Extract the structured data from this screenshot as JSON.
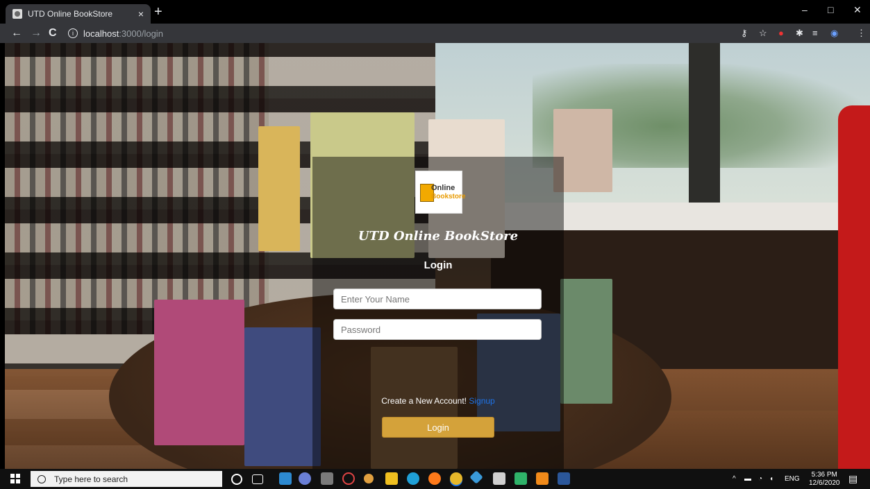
{
  "browser": {
    "tab_title": "UTD Online BookStore",
    "tab_close": "×",
    "new_tab": "+",
    "url_host": "localhost",
    "url_path": ":3000/login",
    "window_controls": {
      "minimize": "–",
      "maximize": "□",
      "close": "✕"
    },
    "nav": {
      "back": "←",
      "forward": "→",
      "reload": "C"
    },
    "info_glyph": "i"
  },
  "login": {
    "logo_line1": "Online",
    "logo_line2": "Bookstore",
    "brand": "UTD Online BookStore",
    "heading": "Login",
    "name_placeholder": "Enter Your Name",
    "password_placeholder": "Password",
    "signup_prompt": "Create a New Account!",
    "signup_link": "Signup",
    "login_button": "Login"
  },
  "taskbar": {
    "search_placeholder": "Type here to search",
    "language": "ENG",
    "time": "5:36 PM",
    "date": "12/6/2020"
  },
  "colors": {
    "login_button": "#d4a23a",
    "signup_link": "#1e73e8",
    "panel_overlay": "rgba(0,0,0,0.45)"
  }
}
